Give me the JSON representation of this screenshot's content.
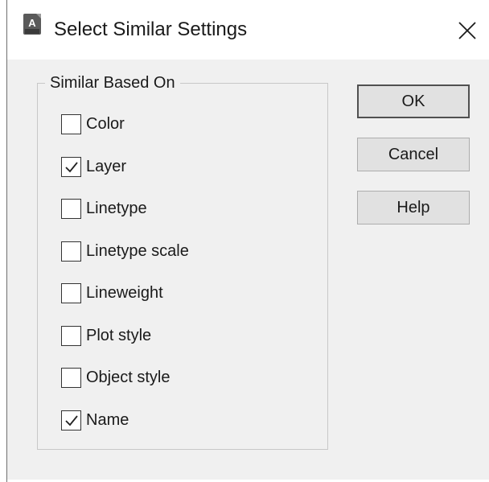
{
  "window": {
    "title": "Select Similar Settings",
    "icon": "autocad-app-icon",
    "icon_badge": "A",
    "close_icon": "close-icon"
  },
  "group": {
    "legend": "Similar Based On",
    "options": [
      {
        "label": "Color",
        "checked": false
      },
      {
        "label": "Layer",
        "checked": true
      },
      {
        "label": "Linetype",
        "checked": false
      },
      {
        "label": "Linetype scale",
        "checked": false
      },
      {
        "label": "Lineweight",
        "checked": false
      },
      {
        "label": "Plot style",
        "checked": false
      },
      {
        "label": "Object style",
        "checked": false
      },
      {
        "label": "Name",
        "checked": true
      }
    ]
  },
  "buttons": {
    "ok": "OK",
    "cancel": "Cancel",
    "help": "Help"
  }
}
